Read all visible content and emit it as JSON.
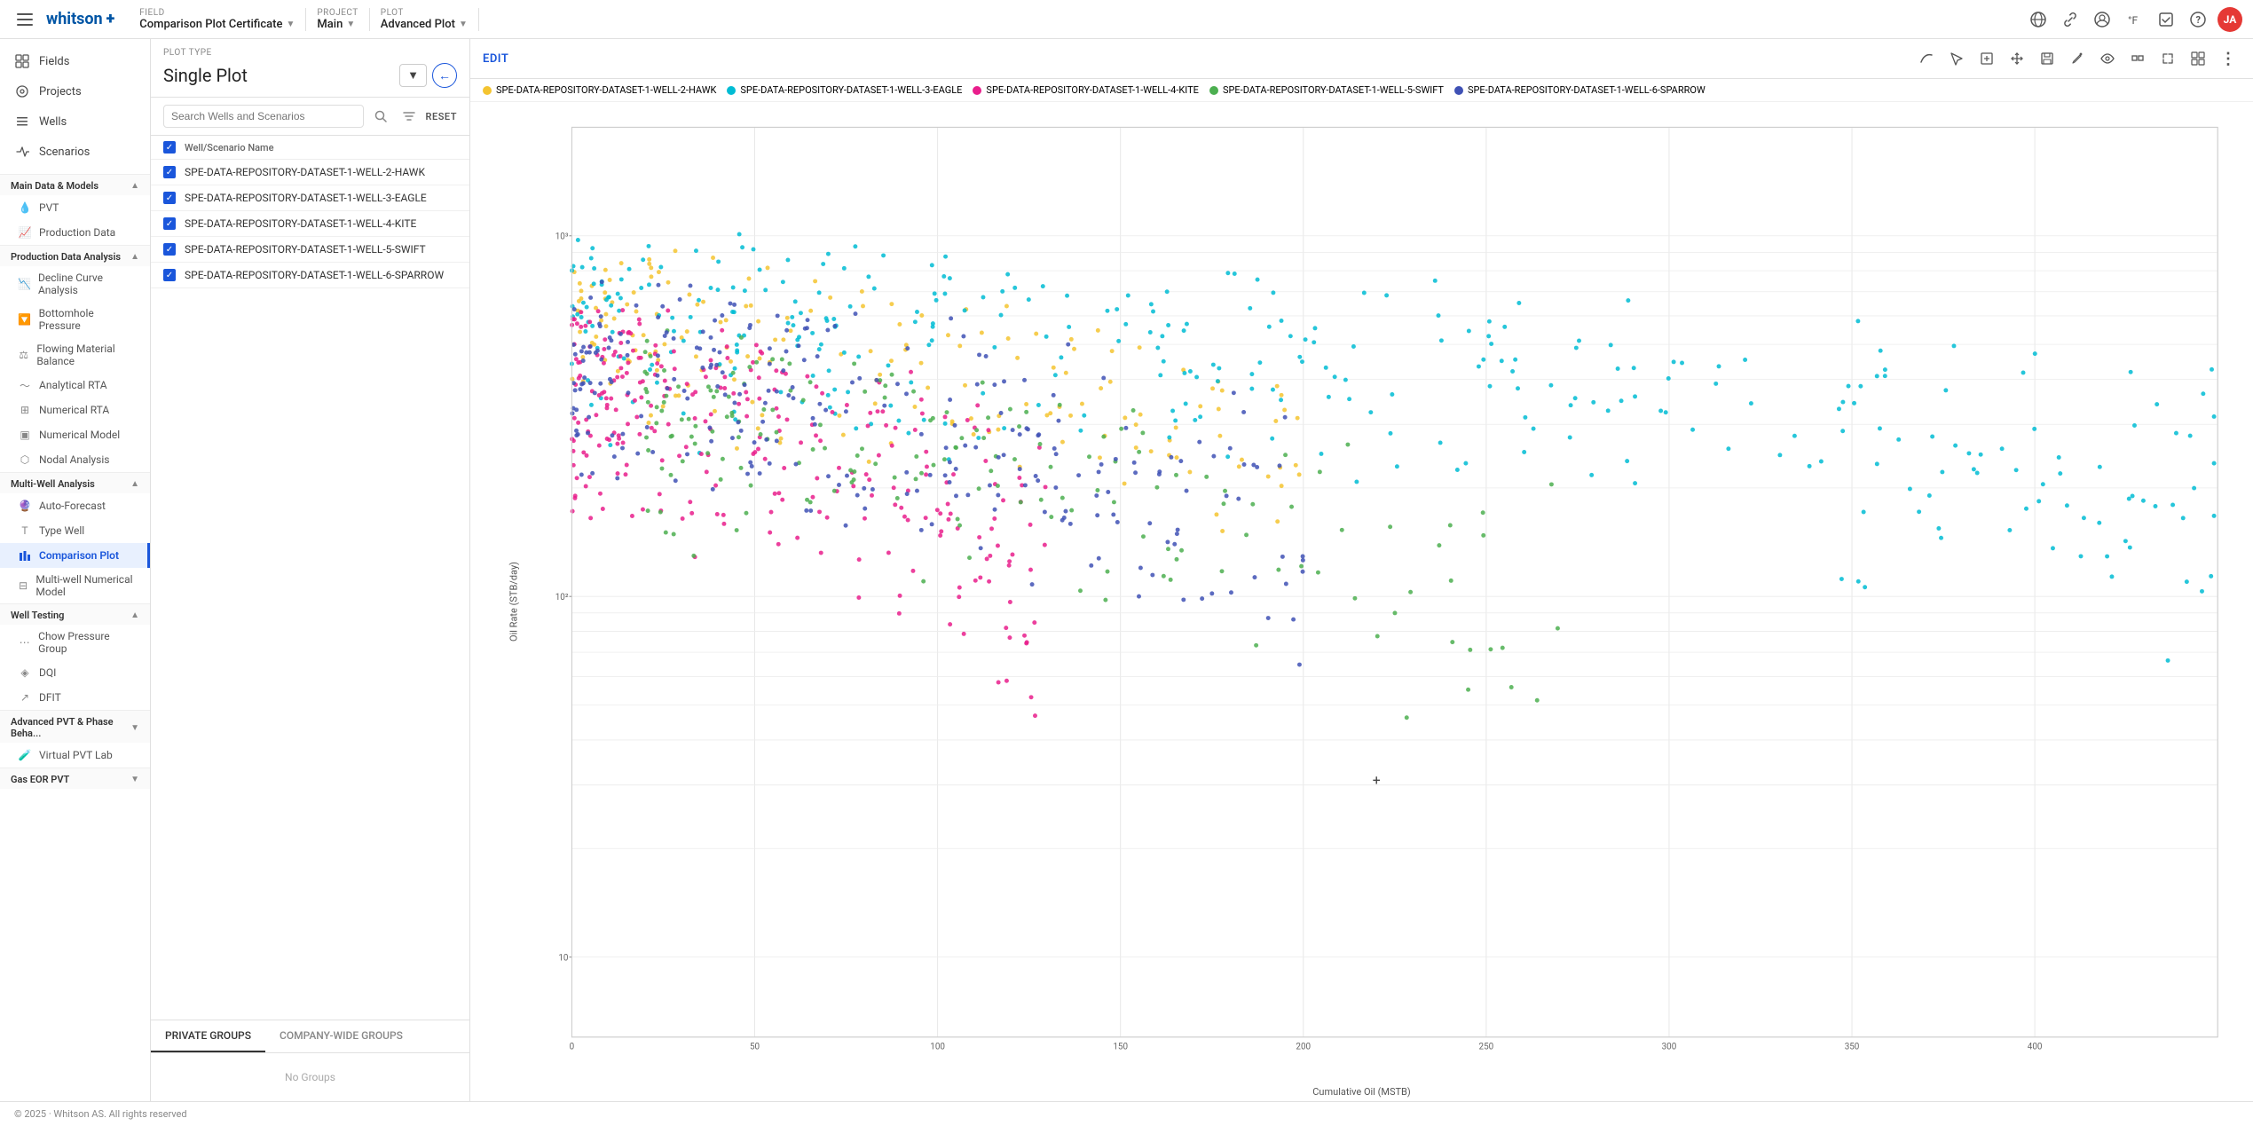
{
  "topbar": {
    "logo": "whitson",
    "logo_plus": "+",
    "hamburger_label": "menu",
    "breadcrumbs": [
      {
        "label": "Field",
        "value": "Comparison Plot Certificate",
        "has_dropdown": true
      },
      {
        "label": "Project",
        "value": "Main",
        "has_dropdown": true
      },
      {
        "label": "Plot",
        "value": "Advanced Plot",
        "has_dropdown": true
      }
    ],
    "icons": [
      "globe",
      "link",
      "user-circle",
      "thermometer",
      "checkbox-square",
      "question-circle",
      "user-avatar"
    ]
  },
  "sidebar": {
    "nav_items": [
      {
        "id": "fields",
        "label": "Fields",
        "icon": "⊞"
      },
      {
        "id": "projects",
        "label": "Projects",
        "icon": "◎"
      },
      {
        "id": "wells",
        "label": "Wells",
        "icon": "≡"
      },
      {
        "id": "scenarios",
        "label": "Scenarios",
        "icon": "⋈"
      }
    ],
    "sections": [
      {
        "id": "main-data",
        "label": "Main Data & Models",
        "expanded": true,
        "items": [
          {
            "id": "pvt",
            "label": "PVT",
            "icon": "drop"
          },
          {
            "id": "production-data",
            "label": "Production Data",
            "icon": "chart-line"
          }
        ]
      },
      {
        "id": "production-data-analysis",
        "label": "Production Data Analysis",
        "expanded": true,
        "items": [
          {
            "id": "decline-curve",
            "label": "Decline Curve Analysis",
            "icon": "trend-down"
          },
          {
            "id": "bottomhole",
            "label": "Bottomhole Pressure",
            "icon": "gauge"
          },
          {
            "id": "flowing-material",
            "label": "Flowing Material Balance",
            "icon": "balance"
          },
          {
            "id": "analytical-rta",
            "label": "Analytical RTA",
            "icon": "wave"
          },
          {
            "id": "numerical-rta",
            "label": "Numerical RTA",
            "icon": "grid"
          },
          {
            "id": "numerical-model",
            "label": "Numerical Model",
            "icon": "cube"
          },
          {
            "id": "nodal-analysis",
            "label": "Nodal Analysis",
            "icon": "node"
          }
        ]
      },
      {
        "id": "multi-well",
        "label": "Multi-Well Analysis",
        "expanded": true,
        "items": [
          {
            "id": "auto-forecast",
            "label": "Auto-Forecast",
            "icon": "forecast"
          },
          {
            "id": "type-well",
            "label": "Type Well",
            "icon": "type"
          },
          {
            "id": "comparison-plot",
            "label": "Comparison Plot",
            "icon": "compare",
            "active": true
          },
          {
            "id": "multi-well-numerical",
            "label": "Multi-well Numerical Model",
            "icon": "multi"
          }
        ]
      },
      {
        "id": "well-testing",
        "label": "Well Testing",
        "expanded": true,
        "items": [
          {
            "id": "chow-pressure",
            "label": "Chow Pressure Group",
            "icon": "pressure"
          },
          {
            "id": "dqi",
            "label": "DQI",
            "icon": "dqi"
          },
          {
            "id": "dfit",
            "label": "DFIT",
            "icon": "dfit"
          }
        ]
      },
      {
        "id": "advanced-pvt",
        "label": "Advanced PVT & Phase Beha...",
        "expanded": false,
        "items": [
          {
            "id": "virtual-pvt-lab",
            "label": "Virtual PVT Lab",
            "icon": "lab"
          }
        ]
      },
      {
        "id": "gas-eor",
        "label": "Gas EOR PVT",
        "expanded": false,
        "items": []
      }
    ]
  },
  "panel": {
    "plot_type_label": "Plot Type",
    "plot_type_value": "Single Plot",
    "search_placeholder": "Search Wells and Scenarios",
    "reset_label": "RESET",
    "table_header": "Well/Scenario Name",
    "wells": [
      {
        "id": "w1",
        "name": "SPE-DATA-REPOSITORY-DATASET-1-WELL-2-HAWK",
        "checked": true
      },
      {
        "id": "w2",
        "name": "SPE-DATA-REPOSITORY-DATASET-1-WELL-3-EAGLE",
        "checked": true
      },
      {
        "id": "w3",
        "name": "SPE-DATA-REPOSITORY-DATASET-1-WELL-4-KITE",
        "checked": true
      },
      {
        "id": "w4",
        "name": "SPE-DATA-REPOSITORY-DATASET-1-WELL-5-SWIFT",
        "checked": true
      },
      {
        "id": "w5",
        "name": "SPE-DATA-REPOSITORY-DATASET-1-WELL-6-SPARROW",
        "checked": true
      }
    ],
    "groups_tabs": [
      {
        "id": "private",
        "label": "PRIVATE GROUPS",
        "active": true
      },
      {
        "id": "company",
        "label": "COMPANY-WIDE GROUPS",
        "active": false
      }
    ],
    "groups_empty": "No Groups"
  },
  "plot": {
    "edit_label": "EDIT",
    "legend": [
      {
        "id": "hawk",
        "label": "SPE-DATA-REPOSITORY-DATASET-1-WELL-2-HAWK",
        "color": "#f4c430"
      },
      {
        "id": "eagle",
        "label": "SPE-DATA-REPOSITORY-DATASET-1-WELL-3-EAGLE",
        "color": "#00bcd4"
      },
      {
        "id": "kite",
        "label": "SPE-DATA-REPOSITORY-DATASET-1-WELL-4-KITE",
        "color": "#e91e8c"
      },
      {
        "id": "swift",
        "label": "SPE-DATA-REPOSITORY-DATASET-1-WELL-5-SWIFT",
        "color": "#4caf50"
      },
      {
        "id": "sparrow",
        "label": "SPE-DATA-REPOSITORY-DATASET-1-WELL-6-SPARROW",
        "color": "#3f51b5"
      }
    ],
    "y_axis_label": "Oil Rate (STB/day)",
    "x_axis_label": "Cumulative Oil (MSTB)",
    "x_ticks": [
      "0",
      "50",
      "100",
      "150",
      "200",
      "250",
      "300",
      "350",
      "400"
    ],
    "y_ticks_log": [
      "10",
      "10²",
      "10³"
    ],
    "tools": [
      {
        "id": "curve",
        "symbol": "⌒"
      },
      {
        "id": "select",
        "symbol": "⌐"
      },
      {
        "id": "rect-zoom",
        "symbol": "▣"
      },
      {
        "id": "pan",
        "symbol": "✋"
      },
      {
        "id": "save",
        "symbol": "💾"
      },
      {
        "id": "edit2",
        "symbol": "✏"
      },
      {
        "id": "eye",
        "symbol": "👁"
      },
      {
        "id": "box",
        "symbol": "⬜"
      },
      {
        "id": "expand",
        "symbol": "⤢"
      },
      {
        "id": "grid",
        "symbol": "⊞"
      },
      {
        "id": "more",
        "symbol": "⋮"
      }
    ]
  },
  "footer": {
    "text": "© 2025 · Whitson AS. All rights reserved"
  }
}
